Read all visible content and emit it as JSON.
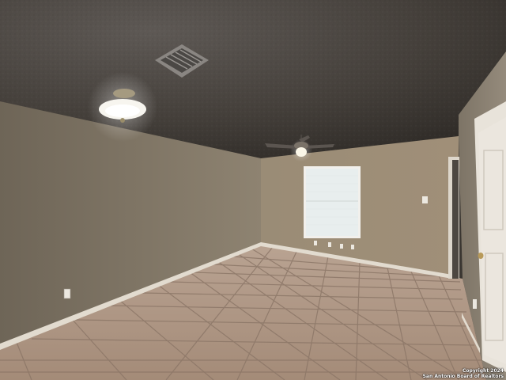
{
  "watermark": {
    "line1": "Copyright 2024",
    "line2": "San Antonio Board of Realtors"
  },
  "colors": {
    "ceiling": "#4a4540",
    "left_wall": "#7f7566",
    "back_wall": "#9a8d78",
    "right_wall": "#8c8374",
    "floor_tile": "#b59d8a",
    "grout": "#8d7a6b",
    "baseboard": "#ddd6ca",
    "door": "#e6e1d9",
    "window_light": "#e9efee"
  },
  "icons": [
    "ceiling-light-fixture",
    "ceiling-fan",
    "air-vent",
    "window",
    "door",
    "electrical-outlet",
    "light-switch"
  ]
}
